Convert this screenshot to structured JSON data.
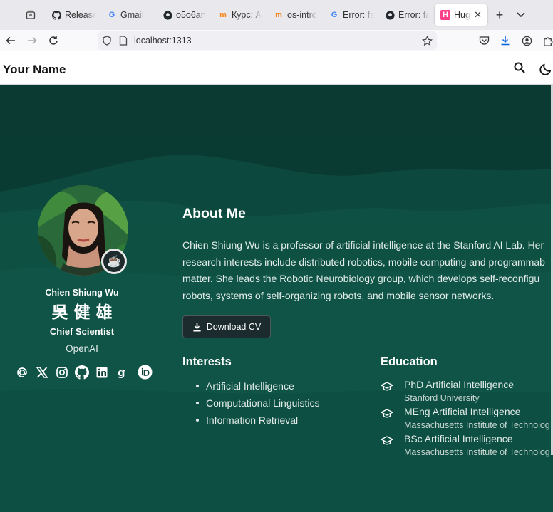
{
  "browser": {
    "tabs": [
      {
        "icon": "github-icon",
        "title": "Release"
      },
      {
        "icon": "google-icon",
        "title": "Gmail"
      },
      {
        "icon": "github-icon",
        "title": "o5o6an"
      },
      {
        "icon": "moodle-icon",
        "title": "Курс: А"
      },
      {
        "icon": "moodle-icon",
        "title": "os-intro"
      },
      {
        "icon": "google-icon",
        "title": "Error: fa"
      },
      {
        "icon": "github-icon",
        "title": "Error: fa"
      },
      {
        "icon": "hugo-icon",
        "title": "Hugo",
        "active": true
      }
    ],
    "url": "localhost:1313"
  },
  "site": {
    "brand": "Your Name"
  },
  "profile": {
    "name": "Chien Shiung Wu",
    "name_cjk": "吳 健 雄",
    "role": "Chief Scientist",
    "org": "OpenAI",
    "socials": [
      "email-icon",
      "x-icon",
      "instagram-icon",
      "github-icon",
      "linkedin-icon",
      "google-scholar-icon",
      "orcid-icon"
    ]
  },
  "about": {
    "heading": "About Me",
    "lines": [
      "Chien Shiung Wu is a professor of artificial intelligence at the Stanford AI Lab. Her",
      "research interests include distributed robotics, mobile computing and programmab",
      "matter. She leads the Robotic Neurobiology group, which develops self-reconfigu",
      "robots, systems of self-organizing robots, and mobile sensor networks."
    ],
    "cv_button": "Download CV"
  },
  "interests": {
    "heading": "Interests",
    "items": [
      "Artificial Intelligence",
      "Computational Linguistics",
      "Information Retrieval"
    ]
  },
  "education": {
    "heading": "Education",
    "items": [
      {
        "degree": "PhD Artificial Intelligence",
        "institution": "Stanford University"
      },
      {
        "degree": "MEng Artificial Intelligence",
        "institution": "Massachusetts Institute of Technolog"
      },
      {
        "degree": "BSc Artificial Intelligence",
        "institution": "Massachusetts Institute of Technolog"
      }
    ]
  },
  "colors": {
    "hero_bg": "#0a3a32",
    "accent_wave": "#0f5446",
    "text": "#ffffff"
  }
}
